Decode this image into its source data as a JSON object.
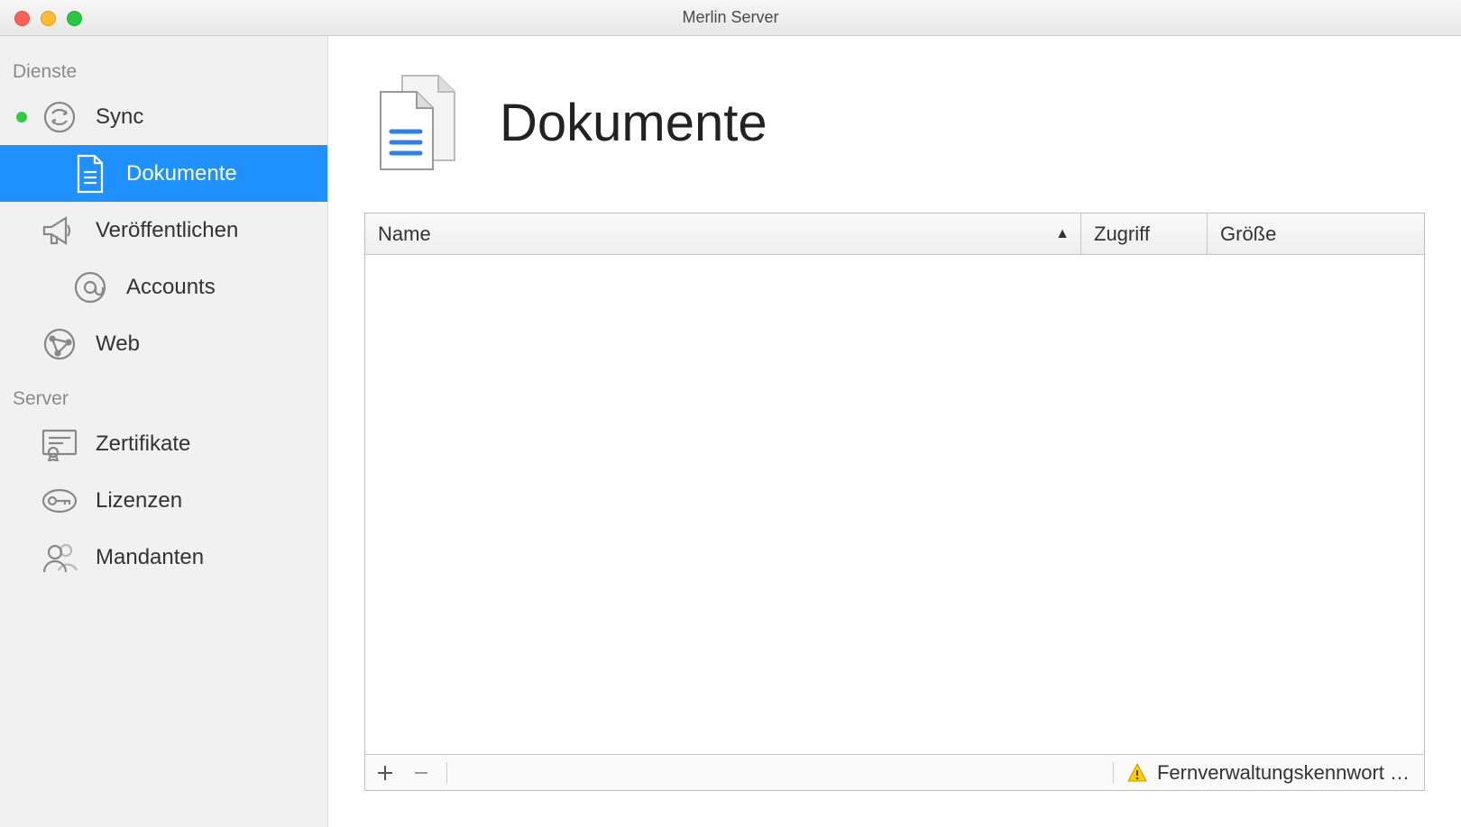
{
  "window": {
    "title": "Merlin Server"
  },
  "sidebar": {
    "sections": [
      {
        "label": "Dienste",
        "items": [
          {
            "id": "sync",
            "label": "Sync",
            "status": "green",
            "indent": 0
          },
          {
            "id": "dokumente",
            "label": "Dokumente",
            "selected": true,
            "indent": 1
          },
          {
            "id": "veroeffentlichen",
            "label": "Veröffentlichen",
            "indent": 0
          },
          {
            "id": "accounts",
            "label": "Accounts",
            "indent": 1
          },
          {
            "id": "web",
            "label": "Web",
            "indent": 0
          }
        ]
      },
      {
        "label": "Server",
        "items": [
          {
            "id": "zertifikate",
            "label": "Zertifikate",
            "indent": 0
          },
          {
            "id": "lizenzen",
            "label": "Lizenzen",
            "indent": 0
          },
          {
            "id": "mandanten",
            "label": "Mandanten",
            "indent": 0
          }
        ]
      }
    ]
  },
  "main": {
    "title": "Dokumente",
    "table": {
      "columns": [
        {
          "label": "Name",
          "sort": "asc"
        },
        {
          "label": "Zugriff"
        },
        {
          "label": "Größe"
        }
      ],
      "rows": []
    },
    "footer": {
      "add_tooltip": "+",
      "remove_tooltip": "−",
      "status_text": "Fernverwaltungskennwort …"
    }
  }
}
